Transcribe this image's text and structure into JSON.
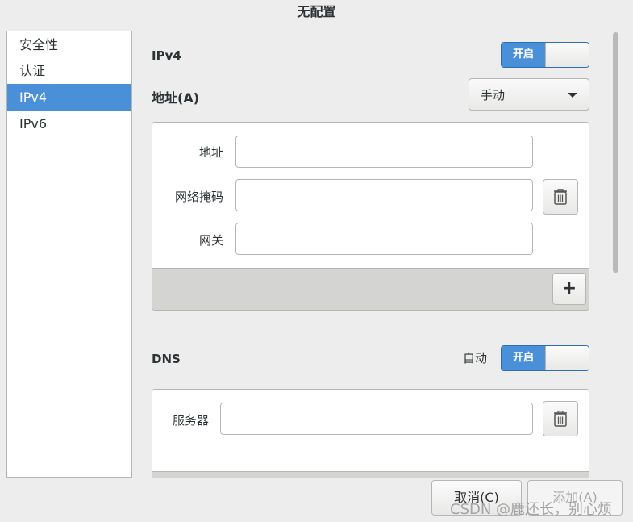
{
  "window": {
    "title": "无配置"
  },
  "sidebar": {
    "items": [
      {
        "label": "安全性"
      },
      {
        "label": "认证"
      },
      {
        "label": "IPv4",
        "selected": true
      },
      {
        "label": "IPv6"
      }
    ]
  },
  "ipv4": {
    "title": "IPv4",
    "switch": {
      "label": "开启",
      "state": "on"
    },
    "method_label": "地址(A)",
    "method_value": "手动",
    "address_fields": {
      "address_label": "地址",
      "netmask_label": "网络掩码",
      "gateway_label": "网关",
      "address_value": "",
      "netmask_value": "",
      "gateway_value": ""
    },
    "delete_icon": "trash-icon",
    "add_label": "+"
  },
  "dns": {
    "title": "DNS",
    "auto_label": "自动",
    "switch": {
      "label": "开启",
      "state": "on"
    },
    "server_label": "服务器",
    "server_value": "",
    "delete_icon": "trash-icon",
    "add_label": "+"
  },
  "buttons": {
    "cancel": "取消(C)",
    "add": "添加(A)"
  },
  "watermark": "CSDN @鹿还长，别心烦",
  "colors": {
    "accent": "#4a90d9",
    "panel_footer": "#d4d4d2"
  }
}
